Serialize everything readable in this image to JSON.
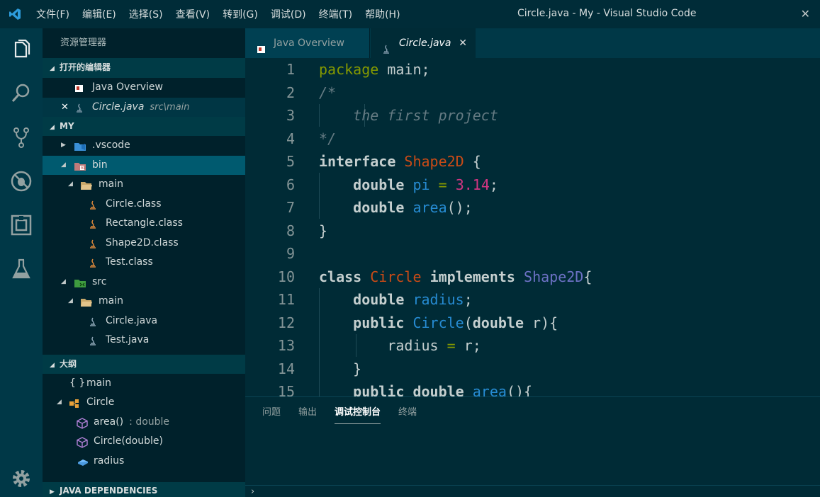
{
  "menu": [
    "文件(F)",
    "编辑(E)",
    "选择(S)",
    "查看(V)",
    "转到(G)",
    "调试(D)",
    "终端(T)",
    "帮助(H)"
  ],
  "window_title": "Circle.java - My - Visual Studio Code",
  "sidebar": {
    "title": "资源管理器",
    "open_editors": {
      "header": "打开的编辑器",
      "items": [
        {
          "label": "Java Overview",
          "desc": ""
        },
        {
          "label": "Circle.java",
          "desc": "src\\main"
        }
      ]
    },
    "workspace": {
      "header": "MY",
      "items": [
        {
          "label": ".vscode"
        },
        {
          "label": "bin"
        },
        {
          "label": "main"
        },
        {
          "label": "Circle.class"
        },
        {
          "label": "Rectangle.class"
        },
        {
          "label": "Shape2D.class"
        },
        {
          "label": "Test.class"
        },
        {
          "label": "src"
        },
        {
          "label": "main"
        },
        {
          "label": "Circle.java"
        },
        {
          "label": "Test.java"
        }
      ]
    },
    "outline": {
      "header": "大纲",
      "items": [
        {
          "label": "main",
          "desc": ""
        },
        {
          "label": "Circle",
          "desc": ""
        },
        {
          "label": "area()",
          "desc": ": double"
        },
        {
          "label": "Circle(double)",
          "desc": ""
        },
        {
          "label": "radius",
          "desc": ""
        }
      ]
    },
    "java_dependencies": {
      "header": "JAVA DEPENDENCIES"
    }
  },
  "tabs": [
    {
      "label": "Java Overview"
    },
    {
      "label": "Circle.java",
      "close": "✕"
    }
  ],
  "code_lines": [
    {
      "n": "1",
      "tokens": [
        [
          "k-pkg",
          "package"
        ],
        [
          "k-plain",
          " main;"
        ]
      ]
    },
    {
      "n": "2",
      "tokens": [
        [
          "k-com",
          "/*"
        ]
      ]
    },
    {
      "n": "3",
      "tokens": [
        [
          "k-com",
          "    the first project"
        ]
      ]
    },
    {
      "n": "4",
      "tokens": [
        [
          "k-com",
          "*/"
        ]
      ]
    },
    {
      "n": "5",
      "tokens": [
        [
          "k-kw",
          "interface"
        ],
        [
          "k-plain",
          " "
        ],
        [
          "k-type",
          "Shape2D"
        ],
        [
          "k-plain",
          " {"
        ]
      ]
    },
    {
      "n": "6",
      "tokens": [
        [
          "k-plain",
          "    "
        ],
        [
          "k-kw",
          "double"
        ],
        [
          "k-plain",
          " "
        ],
        [
          "k-fn",
          "pi"
        ],
        [
          "k-plain",
          " "
        ],
        [
          "k-op",
          "="
        ],
        [
          "k-plain",
          " "
        ],
        [
          "k-num",
          "3.14"
        ],
        [
          "k-plain",
          ";"
        ]
      ]
    },
    {
      "n": "7",
      "tokens": [
        [
          "k-plain",
          "    "
        ],
        [
          "k-kw",
          "double"
        ],
        [
          "k-plain",
          " "
        ],
        [
          "k-fn",
          "area"
        ],
        [
          "k-plain",
          "();"
        ]
      ]
    },
    {
      "n": "8",
      "tokens": [
        [
          "k-plain",
          "}"
        ]
      ]
    },
    {
      "n": "9",
      "tokens": []
    },
    {
      "n": "10",
      "tokens": [
        [
          "k-kw",
          "class"
        ],
        [
          "k-plain",
          " "
        ],
        [
          "k-type",
          "Circle"
        ],
        [
          "k-plain",
          " "
        ],
        [
          "k-kw",
          "implements"
        ],
        [
          "k-plain",
          " "
        ],
        [
          "k-iface",
          "Shape2D"
        ],
        [
          "k-plain",
          "{"
        ]
      ]
    },
    {
      "n": "11",
      "tokens": [
        [
          "k-plain",
          "    "
        ],
        [
          "k-kw",
          "double"
        ],
        [
          "k-plain",
          " "
        ],
        [
          "k-fn",
          "radius"
        ],
        [
          "k-plain",
          ";"
        ]
      ]
    },
    {
      "n": "12",
      "tokens": [
        [
          "k-plain",
          "    "
        ],
        [
          "k-kw",
          "public"
        ],
        [
          "k-plain",
          " "
        ],
        [
          "k-fn",
          "Circle"
        ],
        [
          "k-plain",
          "("
        ],
        [
          "k-kw",
          "double"
        ],
        [
          "k-plain",
          " r){"
        ]
      ]
    },
    {
      "n": "13",
      "tokens": [
        [
          "k-plain",
          "        radius "
        ],
        [
          "k-op",
          "="
        ],
        [
          "k-plain",
          " r;"
        ]
      ]
    },
    {
      "n": "14",
      "tokens": [
        [
          "k-plain",
          "    }"
        ]
      ]
    },
    {
      "n": "15",
      "tokens": [
        [
          "k-plain",
          "    "
        ],
        [
          "k-kw",
          "public"
        ],
        [
          "k-plain",
          " "
        ],
        [
          "k-kw",
          "double"
        ],
        [
          "k-plain",
          " "
        ],
        [
          "k-fn",
          "area"
        ],
        [
          "k-plain",
          "(){"
        ]
      ]
    }
  ],
  "panel": {
    "tabs": [
      "问题",
      "输出",
      "调试控制台",
      "终端"
    ],
    "active_tab": "调试控制台",
    "prompt": "›"
  },
  "colors": {
    "background": "#002b36",
    "sidebar": "#00212b",
    "selection": "#005a6f",
    "accent_blue": "#268bd2"
  }
}
